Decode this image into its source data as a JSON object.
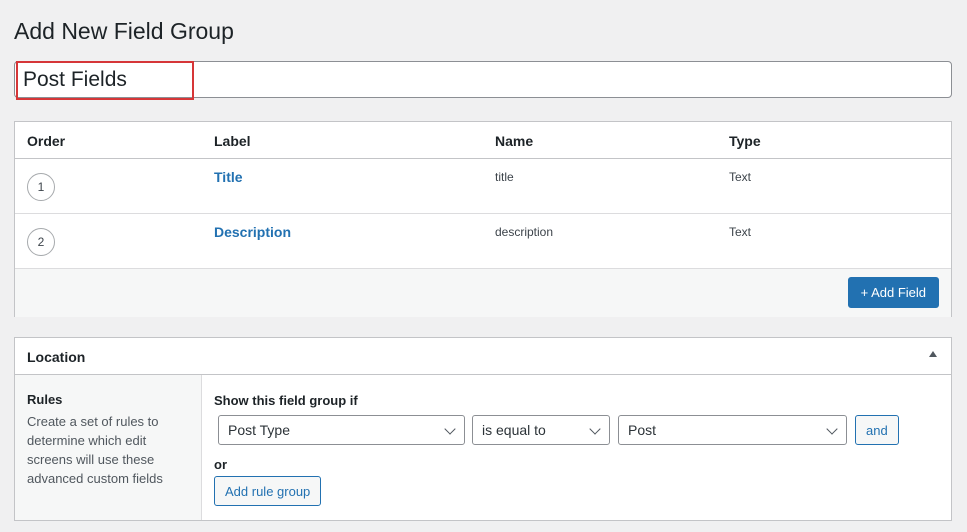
{
  "page": {
    "title": "Add New Field Group"
  },
  "title_input": {
    "value": "Post Fields"
  },
  "fields": {
    "columns": [
      "Order",
      "Label",
      "Name",
      "Type"
    ],
    "rows": [
      {
        "order": "1",
        "label": "Title",
        "name": "title",
        "type": "Text"
      },
      {
        "order": "2",
        "label": "Description",
        "name": "description",
        "type": "Text"
      }
    ],
    "add_button": "+ Add Field"
  },
  "location": {
    "title": "Location",
    "rules_title": "Rules",
    "rules_desc": "Create a set of rules to determine which edit screens will use these advanced custom fields",
    "show_label": "Show this field group if",
    "param_select": "Post Type",
    "operator_select": "is equal to",
    "value_select": "Post",
    "and_button": "and",
    "or_label": "or",
    "add_group_button": "Add rule group"
  },
  "colors": {
    "accent": "#2271b1",
    "highlight": "#d63638"
  }
}
